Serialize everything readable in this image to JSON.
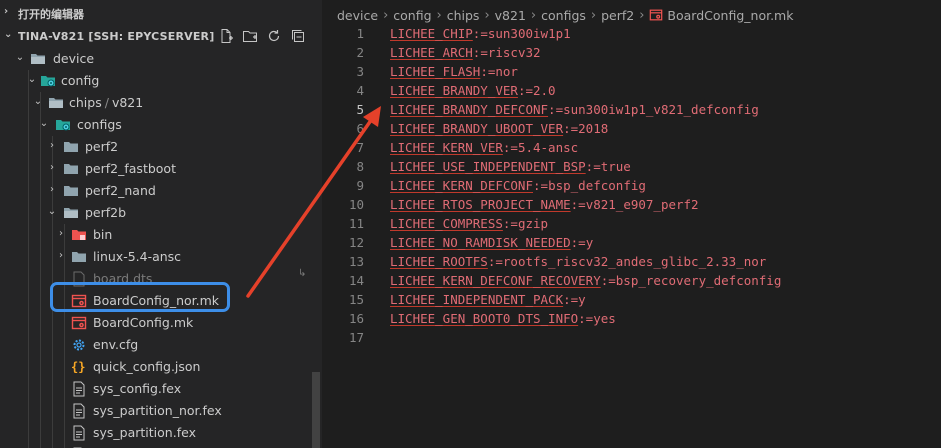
{
  "explorer": {
    "open_editors_label": "打开的编辑器",
    "workspace_label": "TINA-V821 [SSH: EPYCSERVER]",
    "actions": [
      "new-file-icon",
      "new-folder-icon",
      "refresh-icon",
      "collapse-all-icon"
    ],
    "tree": [
      {
        "label": "device",
        "type": "folder",
        "expanded": true
      },
      {
        "label": "config",
        "type": "folder-config",
        "expanded": true
      },
      {
        "label": "chips",
        "label2": "v821",
        "type": "folder",
        "expanded": true
      },
      {
        "label": "configs",
        "type": "folder-config",
        "expanded": true
      },
      {
        "label": "perf2",
        "type": "folder",
        "expanded": false
      },
      {
        "label": "perf2_fastboot",
        "type": "folder",
        "expanded": false
      },
      {
        "label": "perf2_nand",
        "type": "folder",
        "expanded": false
      },
      {
        "label": "perf2b",
        "type": "folder",
        "expanded": true
      },
      {
        "label": "bin",
        "type": "folder-bin",
        "expanded": false
      },
      {
        "label": "linux-5.4-ansc",
        "type": "folder",
        "expanded": false
      },
      {
        "label": "board.dts",
        "type": "file-dim"
      },
      {
        "label": "BoardConfig_nor.mk",
        "type": "file-mk"
      },
      {
        "label": "BoardConfig.mk",
        "type": "file-mk"
      },
      {
        "label": "env.cfg",
        "type": "file-gear"
      },
      {
        "label": "quick_config.json",
        "type": "file-json"
      },
      {
        "label": "sys_config.fex",
        "type": "file-text"
      },
      {
        "label": "sys_partition_nor.fex",
        "type": "file-text"
      },
      {
        "label": "sys_partition.fex",
        "type": "file-text"
      }
    ]
  },
  "breadcrumb": [
    "device",
    "config",
    "chips",
    "v821",
    "configs",
    "perf2",
    "BoardConfig_nor.mk"
  ],
  "editor": {
    "lines": [
      {
        "key": "LICHEE_CHIP",
        "val": "sun300iw1p1"
      },
      {
        "key": "LICHEE_ARCH",
        "val": "riscv32"
      },
      {
        "key": "LICHEE_FLASH",
        "val": "nor"
      },
      {
        "key": "LICHEE_BRANDY_VER",
        "val": "2.0"
      },
      {
        "key": "LICHEE_BRANDY_DEFCONF",
        "val": "sun300iw1p1_v821_defconfig"
      },
      {
        "key": "LICHEE_BRANDY_UBOOT_VER",
        "val": "2018"
      },
      {
        "key": "LICHEE_KERN_VER",
        "val": "5.4-ansc"
      },
      {
        "key": "LICHEE_USE_INDEPENDENT_BSP",
        "val": "true"
      },
      {
        "key": "LICHEE_KERN_DEFCONF",
        "val": "bsp_defconfig"
      },
      {
        "key": "LICHEE_RTOS_PROJECT_NAME",
        "val": "v821_e907_perf2"
      },
      {
        "key": "LICHEE_COMPRESS",
        "val": "gzip"
      },
      {
        "key": "LICHEE_NO_RAMDISK_NEEDED",
        "val": "y"
      },
      {
        "key": "LICHEE_ROOTFS",
        "val": "rootfs_riscv32_andes_glibc_2.33_nor"
      },
      {
        "key": "LICHEE_KERN_DEFCONF_RECOVERY",
        "val": "bsp_recovery_defconfig"
      },
      {
        "key": "LICHEE_INDEPENDENT_PACK",
        "val": "y"
      },
      {
        "key": "LICHEE_GEN_BOOT0_DTS_INFO",
        "val": "yes"
      },
      {
        "key": "",
        "val": ""
      }
    ],
    "operator": ":=",
    "line_numbers": [
      "1",
      "2",
      "3",
      "4",
      "5",
      "6",
      "7",
      "8",
      "9",
      "10",
      "11",
      "12",
      "13",
      "14",
      "15",
      "16",
      "17"
    ]
  },
  "colors": {
    "annotation_arrow": "#e5412a",
    "highlight_box": "#3d8ee8",
    "code_text": "#e06c75"
  }
}
